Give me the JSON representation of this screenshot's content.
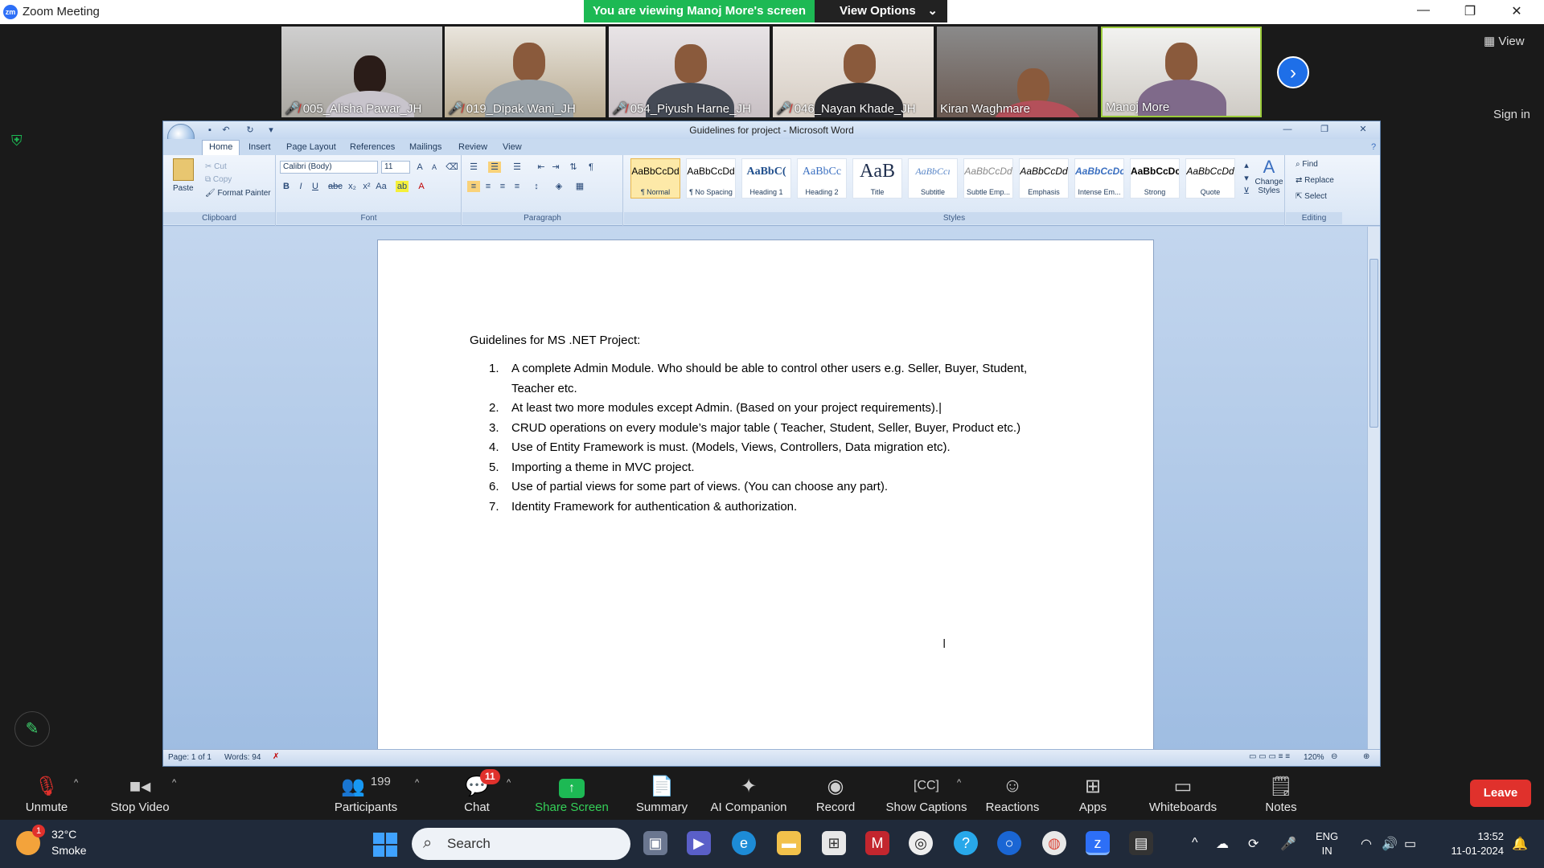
{
  "zoom": {
    "app_title": "Zoom Meeting",
    "logo_text": "zm",
    "banner": "You are viewing Manoj More's screen",
    "view_options": "View Options",
    "view_button": "View",
    "sign_in": "Sign in",
    "participants_tiles": [
      {
        "name": "005_Alisha Pawar_JH",
        "muted": true
      },
      {
        "name": "019_Dipak Wani_JH",
        "muted": true
      },
      {
        "name": "054_Piyush Harne_JH",
        "muted": true
      },
      {
        "name": "046_Nayan Khade_JH",
        "muted": true
      },
      {
        "name": "Kiran Waghmare",
        "muted": false
      },
      {
        "name": "Manoj More",
        "muted": false
      }
    ],
    "toolbar": {
      "unmute": "Unmute",
      "stop_video": "Stop Video",
      "participants": "Participants",
      "participants_count": "199",
      "chat": "Chat",
      "chat_badge": "11",
      "share_screen": "Share Screen",
      "summary": "Summary",
      "ai_companion": "AI Companion",
      "record": "Record",
      "show_captions": "Show Captions",
      "reactions": "Reactions",
      "apps": "Apps",
      "whiteboards": "Whiteboards",
      "notes": "Notes",
      "leave": "Leave"
    },
    "accent_green": "#1db954",
    "accent_red": "#e0312c"
  },
  "word": {
    "window_title": "Guidelines for project - Microsoft Word",
    "tabs": [
      "Home",
      "Insert",
      "Page Layout",
      "References",
      "Mailings",
      "Review",
      "View"
    ],
    "clipboard": {
      "paste": "Paste",
      "cut": "Cut",
      "copy": "Copy",
      "format_painter": "Format Painter",
      "label": "Clipboard"
    },
    "font": {
      "name": "Calibri (Body)",
      "size": "11",
      "label": "Font"
    },
    "paragraph_label": "Paragraph",
    "styles": {
      "label": "Styles",
      "items": [
        {
          "preview": "AaBbCcDd",
          "name": "¶ Normal"
        },
        {
          "preview": "AaBbCcDd",
          "name": "¶ No Spacing"
        },
        {
          "preview": "AaBbC(",
          "name": "Heading 1"
        },
        {
          "preview": "AaBbCc",
          "name": "Heading 2"
        },
        {
          "preview": "AaB",
          "name": "Title"
        },
        {
          "preview": "AaBbCcı",
          "name": "Subtitle"
        },
        {
          "preview": "AaBbCcDd",
          "name": "Subtle Emp..."
        },
        {
          "preview": "AaBbCcDd",
          "name": "Emphasis"
        },
        {
          "preview": "AaBbCcDc",
          "name": "Intense Em..."
        },
        {
          "preview": "AaBbCcDc",
          "name": "Strong"
        },
        {
          "preview": "AaBbCcDd",
          "name": "Quote"
        }
      ],
      "change_styles": "Change Styles"
    },
    "editing": {
      "find": "Find",
      "replace": "Replace",
      "select": "Select",
      "label": "Editing"
    },
    "document": {
      "heading": "Guidelines for MS .NET Project:",
      "items": [
        {
          "num": "1.",
          "text": "A complete Admin Module. Who should be able to control other users e.g. Seller, Buyer, Student, Teacher etc."
        },
        {
          "num": "2.",
          "text": "At least two more modules except Admin. (Based on your project requirements)."
        },
        {
          "num": "3.",
          "text": "CRUD operations on every module’s major table ( Teacher, Student, Seller, Buyer, Product etc.)"
        },
        {
          "num": "4.",
          "text": "Use of Entity Framework is must. (Models, Views, Controllers, Data migration etc)."
        },
        {
          "num": "5.",
          "text": "Importing a theme in MVC project."
        },
        {
          "num": "6.",
          "text": "Use of partial views for some part of views. (You can choose any part)."
        },
        {
          "num": "7.",
          "text": "Identity Framework for authentication & authorization."
        }
      ]
    },
    "status": {
      "page": "Page: 1 of 1",
      "words": "Words: 94",
      "zoom": "120%"
    }
  },
  "taskbar": {
    "weather_temp": "32°C",
    "weather_cond": "Smoke",
    "weather_badge": "1",
    "search": "Search",
    "lang_top": "ENG",
    "lang_bottom": "IN",
    "time": "13:52",
    "date": "11-01-2024"
  }
}
